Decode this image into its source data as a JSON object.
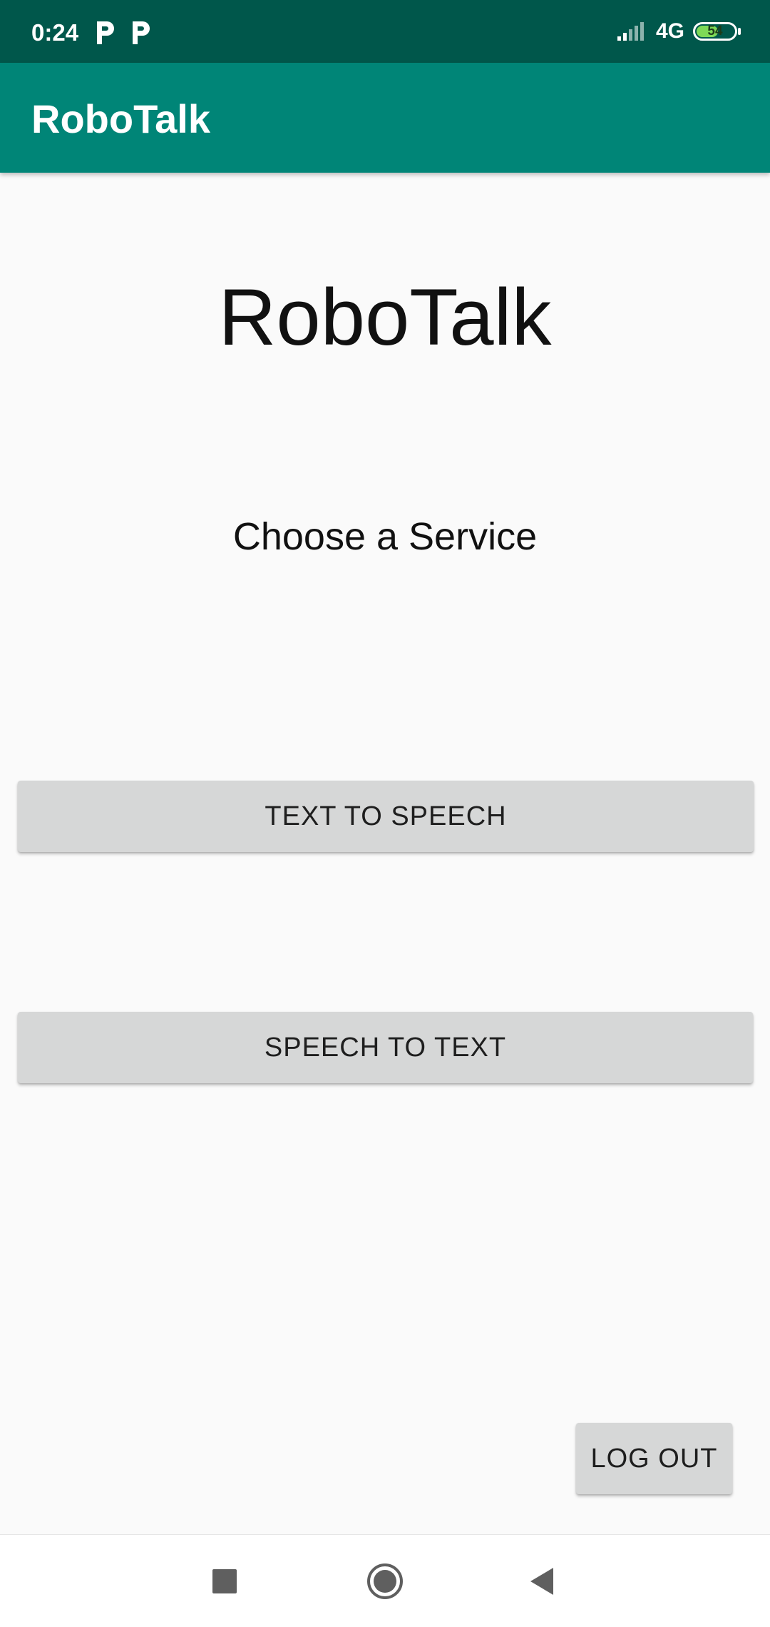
{
  "status_bar": {
    "time": "0:24",
    "notification_icons": [
      "parking-icon",
      "parking-icon"
    ],
    "network": "4G",
    "battery_level": "54"
  },
  "app_bar": {
    "title": "RoboTalk"
  },
  "main": {
    "title": "RoboTalk",
    "subtitle": "Choose a Service",
    "buttons": {
      "text_to_speech": "TEXT TO SPEECH",
      "speech_to_text": "SPEECH TO TEXT",
      "log_out": "LOG OUT"
    }
  },
  "nav_bar": {
    "icons": [
      "recents-icon",
      "home-icon",
      "back-icon"
    ]
  },
  "colors": {
    "status_bar": "#00574b",
    "app_bar": "#008577",
    "button": "#d6d7d7",
    "background": "#fafafa"
  }
}
